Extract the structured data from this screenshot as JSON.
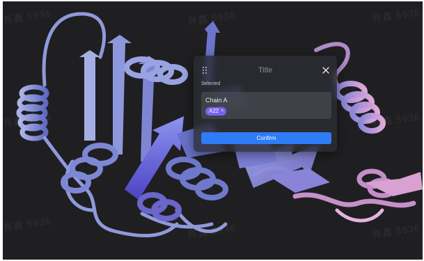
{
  "dialog": {
    "title": "Title",
    "section_label": "Selected",
    "chain_name": "Chain A",
    "tags": [
      {
        "label": "A22",
        "remove_glyph": "×"
      }
    ],
    "confirm_label": "Confirm",
    "close_icon": "close-icon",
    "drag_icon": "drag-handle-icon"
  },
  "watermark": {
    "text": "肖鑫 5936"
  },
  "colors": {
    "background": "#1f1f22",
    "accent": "#2e7cf6",
    "tag": "#7b61ef",
    "protein_blue": "#6b78c9",
    "protein_violet": "#6a55d6",
    "protein_pink": "#c68ac0"
  }
}
